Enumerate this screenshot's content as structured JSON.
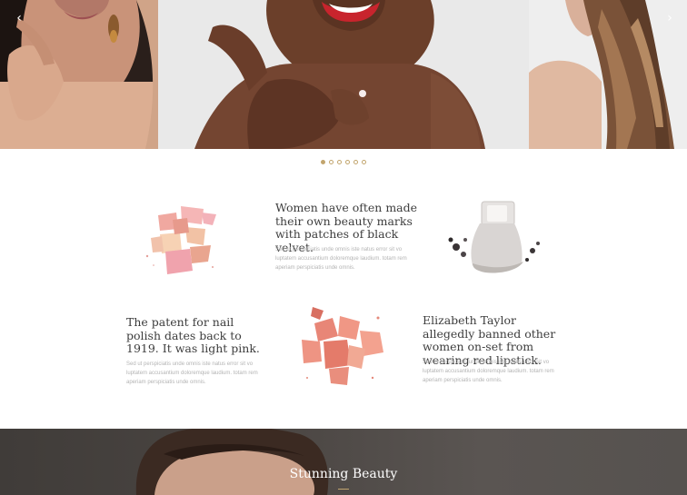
{
  "slider": {
    "prev_icon": "chevron-left-icon",
    "next_icon": "chevron-right-icon",
    "dots": [
      true,
      false,
      false,
      false,
      false,
      false
    ],
    "accent": "#c2a56e"
  },
  "facts": [
    {
      "title": "Women have often made their own beauty marks with patches of black velvet.",
      "body": "Sed ut perspiciatis unde omnis iste natus error sit vo luptatem accusantium doloremque laudium. totam rem aperiam perspiciatis unde omnis."
    },
    {
      "title": "The patent for nail polish dates back to 1919. It was light pink.",
      "body": "Sed ut perspiciatis unde omnis iste natus error sit vo luptatem accusantium doloremque laudium. totam rem aperiam perspiciatis unde omnis."
    },
    {
      "title": "Elizabeth Taylor allegedly banned other women on-set from wearing red lipstick.",
      "body": "Sed ut perspiciatis unde omnis iste natus error sit vo luptatem accusantium doloremque laudium. totam rem aperiam perspiciatis unde omnis."
    }
  ],
  "section": {
    "title": "Stunning Beauty"
  }
}
